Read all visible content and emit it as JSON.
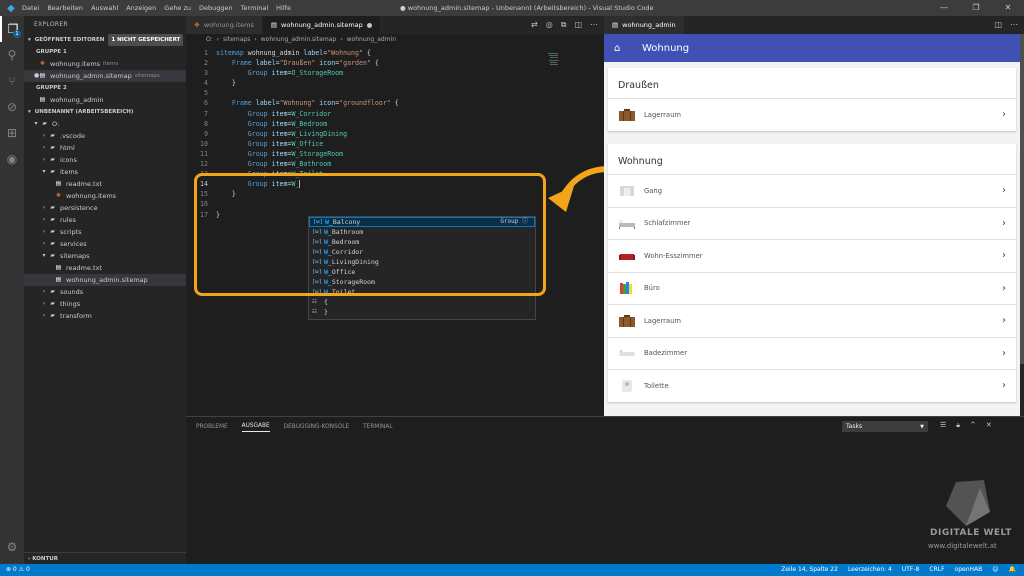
{
  "titlebar": {
    "menu": [
      "Datei",
      "Bearbeiten",
      "Auswahl",
      "Anzeigen",
      "Gehe zu",
      "Debuggen",
      "Terminal",
      "Hilfe"
    ],
    "title": "● wohnung_admin.sitemap - Unbenannt (Arbeitsbereich) - Visual Studio Code",
    "controls": [
      "—",
      "❐",
      "✕"
    ]
  },
  "activity": {
    "badge": "1"
  },
  "explorer": {
    "title": "EXPLORER",
    "open_editors": {
      "label": "GEÖFFNETE EDITOREN",
      "dirty": "1 NICHT GESPEICHERT"
    },
    "group1": "GRUPPE 1",
    "g1_items": [
      {
        "name": "wohnung.items",
        "desc": "items"
      },
      {
        "name": "wohnung_admin.sitemap",
        "desc": "sitemaps"
      }
    ],
    "group2": "GRUPPE 2",
    "g2_items": [
      {
        "name": "wohnung_admin"
      }
    ],
    "workspace": "UNBENANNT (ARBEITSBEREICH)",
    "root": "O:",
    "tree": [
      {
        "name": ".vscode"
      },
      {
        "name": "html"
      },
      {
        "name": "icons"
      },
      {
        "name": "items"
      },
      {
        "name": "readme.txt"
      },
      {
        "name": "wohnung.items"
      },
      {
        "name": "persistence"
      },
      {
        "name": "rules"
      },
      {
        "name": "scripts"
      },
      {
        "name": "services"
      },
      {
        "name": "sitemaps"
      },
      {
        "name": "readme.txt"
      },
      {
        "name": "wohnung_admin.sitemap"
      },
      {
        "name": "sounds"
      },
      {
        "name": "things"
      },
      {
        "name": "transform"
      }
    ],
    "kontur": "KONTUR"
  },
  "editor": {
    "tabs": [
      "wohnung.items",
      "wohnung_admin.sitemap"
    ],
    "breadcrumb": [
      "O:",
      "sitemaps",
      "wohnung_admin.sitemap",
      "wohnung_admin"
    ],
    "line_numbers": [
      "1",
      "2",
      "3",
      "4",
      "5",
      "6",
      "7",
      "8",
      "9",
      "10",
      "11",
      "12",
      "13",
      "14",
      "15",
      "16",
      "17"
    ],
    "code": {
      "l1": [
        "sitemap",
        " wohnung_admin ",
        "label",
        "=",
        "\"Wohnung\"",
        " {"
      ],
      "l2": [
        "Frame",
        " ",
        "label",
        "=",
        "\"Draußen\"",
        " ",
        "icon",
        "=",
        "\"garden\"",
        " {"
      ],
      "l3": [
        "Group",
        " ",
        "item",
        "=",
        "O_StorageRoom"
      ],
      "l4": [
        "}"
      ],
      "l6": [
        "Frame",
        " ",
        "label",
        "=",
        "\"Wohnung\"",
        " ",
        "icon",
        "=",
        "\"groundfloor\"",
        " {"
      ],
      "group_items": [
        "W_Corridor",
        "W_Bedroom",
        "W_LivingDining",
        "W_Office",
        "W_StorageRoom",
        "W_Bathroom",
        "W_Toilet"
      ],
      "l14": "W_",
      "l15": "}",
      "l17": "}"
    }
  },
  "suggest": {
    "items": [
      {
        "rest": "Balcony",
        "detail": "Group ⓘ"
      },
      {
        "rest": "Bathroom"
      },
      {
        "rest": "Bedroom"
      },
      {
        "rest": "Corridor"
      },
      {
        "rest": "LivingDining"
      },
      {
        "rest": "Office"
      },
      {
        "rest": "StorageRoom"
      },
      {
        "rest": "Toilet"
      }
    ],
    "prefix": "W_",
    "snippets": [
      "{",
      "}"
    ]
  },
  "panel": {
    "tabs": [
      "PROBLEME",
      "AUSGABE",
      "DEBUGGING-KONSOLE",
      "TERMINAL"
    ],
    "select_value": "Tasks"
  },
  "preview": {
    "tab": "wohnung_admin",
    "app_title": "Wohnung",
    "frames": [
      {
        "title": "Draußen",
        "items": [
          "Lagerraum"
        ]
      },
      {
        "title": "Wohnung",
        "items": [
          "Gang",
          "Schlafzimmer",
          "Wohn-Esszimmer",
          "Büro",
          "Lagerraum",
          "Badezimmer",
          "Toilette"
        ]
      }
    ]
  },
  "watermark": {
    "brand": "DIGITALE WELT",
    "url": "www.digitalewelt.at"
  },
  "status": {
    "left": "⊗ 0  ⚠ 0",
    "right": [
      "Zeile 14, Spalte 22",
      "Leerzeichen: 4",
      "UTF-8",
      "CRLF",
      "openHAB",
      "☺",
      "🔔"
    ]
  },
  "colors": {
    "accent": "#007acc",
    "highlight": "#f2a51a",
    "appbar": "#3f51b5"
  }
}
